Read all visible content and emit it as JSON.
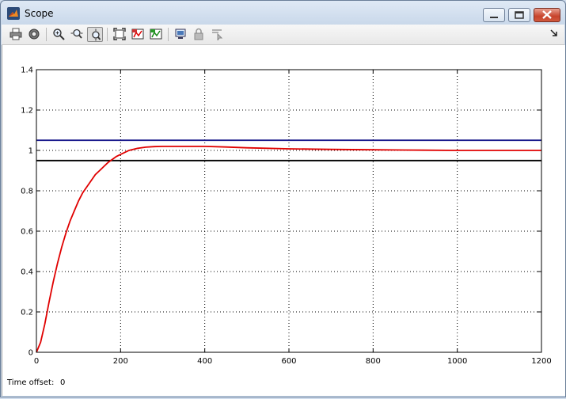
{
  "window": {
    "title": "Scope"
  },
  "toolbar": {
    "buttons": [
      {
        "name": "print",
        "icon": "printer-icon"
      },
      {
        "name": "parameters",
        "icon": "gear-icon"
      },
      {
        "name": "zoom",
        "icon": "zoom-in-icon"
      },
      {
        "name": "zoom-x",
        "icon": "zoom-x-icon"
      },
      {
        "name": "zoom-y",
        "icon": "zoom-y-icon",
        "pressed": true
      },
      {
        "name": "autoscale",
        "icon": "autoscale-icon"
      },
      {
        "name": "save-axes",
        "icon": "save-axes-icon"
      },
      {
        "name": "restore-axes",
        "icon": "restore-axes-icon"
      },
      {
        "name": "floating-scope",
        "icon": "floating-scope-icon"
      },
      {
        "name": "lock-axes",
        "icon": "lock-icon"
      },
      {
        "name": "signal-selector",
        "icon": "signal-selector-icon"
      }
    ]
  },
  "footer": {
    "time_offset_label": "Time offset:",
    "time_offset_value": "0"
  },
  "colors": {
    "blue": "#1a1a8c",
    "black": "#000000",
    "red": "#e00000"
  },
  "chart_data": {
    "type": "line",
    "title": "",
    "xlabel": "",
    "ylabel": "",
    "xlim": [
      0,
      1200
    ],
    "ylim": [
      0,
      1.4
    ],
    "xticks": [
      0,
      200,
      400,
      600,
      800,
      1000,
      1200
    ],
    "yticks": [
      0,
      0.2,
      0.4,
      0.6,
      0.8,
      1,
      1.2,
      1.4
    ],
    "xtick_labels": [
      "0",
      "200",
      "400",
      "600",
      "800",
      "1000",
      "1200"
    ],
    "ytick_labels": [
      "0",
      "0.2",
      "0.4",
      "0.6",
      "0.8",
      "1",
      "1.2",
      "1.4"
    ],
    "grid": true,
    "series": [
      {
        "color": "#1a1a8c",
        "x": [
          0,
          1200
        ],
        "y": [
          1.05,
          1.05
        ]
      },
      {
        "color": "#000000",
        "x": [
          0,
          1200
        ],
        "y": [
          0.95,
          0.95
        ]
      },
      {
        "color": "#e00000",
        "x": [
          0,
          10,
          20,
          30,
          40,
          50,
          60,
          70,
          80,
          90,
          100,
          110,
          120,
          130,
          140,
          150,
          160,
          170,
          180,
          190,
          200,
          220,
          240,
          260,
          280,
          300,
          350,
          400,
          450,
          500,
          600,
          700,
          800,
          920,
          1000,
          1200
        ],
        "y": [
          0,
          0.05,
          0.14,
          0.25,
          0.35,
          0.44,
          0.52,
          0.59,
          0.65,
          0.7,
          0.75,
          0.79,
          0.82,
          0.85,
          0.88,
          0.9,
          0.92,
          0.94,
          0.955,
          0.97,
          0.98,
          1.0,
          1.01,
          1.016,
          1.019,
          1.02,
          1.02,
          1.02,
          1.017,
          1.013,
          1.008,
          1.005,
          1.003,
          1.001,
          1.0,
          1.0
        ]
      }
    ]
  }
}
